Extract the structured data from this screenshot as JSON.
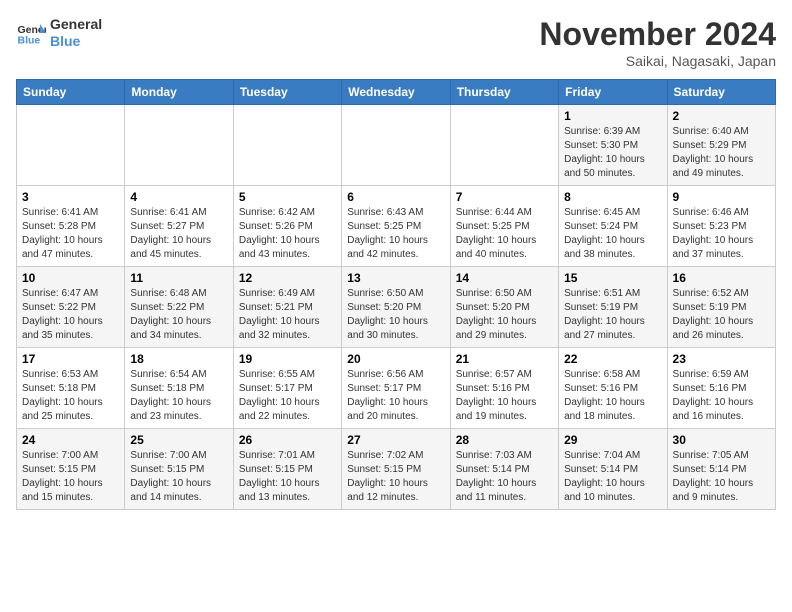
{
  "logo": {
    "line1": "General",
    "line2": "Blue"
  },
  "title": "November 2024",
  "subtitle": "Saikai, Nagasaki, Japan",
  "days_header": [
    "Sunday",
    "Monday",
    "Tuesday",
    "Wednesday",
    "Thursday",
    "Friday",
    "Saturday"
  ],
  "weeks": [
    [
      {
        "day": "",
        "info": ""
      },
      {
        "day": "",
        "info": ""
      },
      {
        "day": "",
        "info": ""
      },
      {
        "day": "",
        "info": ""
      },
      {
        "day": "",
        "info": ""
      },
      {
        "day": "1",
        "info": "Sunrise: 6:39 AM\nSunset: 5:30 PM\nDaylight: 10 hours\nand 50 minutes."
      },
      {
        "day": "2",
        "info": "Sunrise: 6:40 AM\nSunset: 5:29 PM\nDaylight: 10 hours\nand 49 minutes."
      }
    ],
    [
      {
        "day": "3",
        "info": "Sunrise: 6:41 AM\nSunset: 5:28 PM\nDaylight: 10 hours\nand 47 minutes."
      },
      {
        "day": "4",
        "info": "Sunrise: 6:41 AM\nSunset: 5:27 PM\nDaylight: 10 hours\nand 45 minutes."
      },
      {
        "day": "5",
        "info": "Sunrise: 6:42 AM\nSunset: 5:26 PM\nDaylight: 10 hours\nand 43 minutes."
      },
      {
        "day": "6",
        "info": "Sunrise: 6:43 AM\nSunset: 5:25 PM\nDaylight: 10 hours\nand 42 minutes."
      },
      {
        "day": "7",
        "info": "Sunrise: 6:44 AM\nSunset: 5:25 PM\nDaylight: 10 hours\nand 40 minutes."
      },
      {
        "day": "8",
        "info": "Sunrise: 6:45 AM\nSunset: 5:24 PM\nDaylight: 10 hours\nand 38 minutes."
      },
      {
        "day": "9",
        "info": "Sunrise: 6:46 AM\nSunset: 5:23 PM\nDaylight: 10 hours\nand 37 minutes."
      }
    ],
    [
      {
        "day": "10",
        "info": "Sunrise: 6:47 AM\nSunset: 5:22 PM\nDaylight: 10 hours\nand 35 minutes."
      },
      {
        "day": "11",
        "info": "Sunrise: 6:48 AM\nSunset: 5:22 PM\nDaylight: 10 hours\nand 34 minutes."
      },
      {
        "day": "12",
        "info": "Sunrise: 6:49 AM\nSunset: 5:21 PM\nDaylight: 10 hours\nand 32 minutes."
      },
      {
        "day": "13",
        "info": "Sunrise: 6:50 AM\nSunset: 5:20 PM\nDaylight: 10 hours\nand 30 minutes."
      },
      {
        "day": "14",
        "info": "Sunrise: 6:50 AM\nSunset: 5:20 PM\nDaylight: 10 hours\nand 29 minutes."
      },
      {
        "day": "15",
        "info": "Sunrise: 6:51 AM\nSunset: 5:19 PM\nDaylight: 10 hours\nand 27 minutes."
      },
      {
        "day": "16",
        "info": "Sunrise: 6:52 AM\nSunset: 5:19 PM\nDaylight: 10 hours\nand 26 minutes."
      }
    ],
    [
      {
        "day": "17",
        "info": "Sunrise: 6:53 AM\nSunset: 5:18 PM\nDaylight: 10 hours\nand 25 minutes."
      },
      {
        "day": "18",
        "info": "Sunrise: 6:54 AM\nSunset: 5:18 PM\nDaylight: 10 hours\nand 23 minutes."
      },
      {
        "day": "19",
        "info": "Sunrise: 6:55 AM\nSunset: 5:17 PM\nDaylight: 10 hours\nand 22 minutes."
      },
      {
        "day": "20",
        "info": "Sunrise: 6:56 AM\nSunset: 5:17 PM\nDaylight: 10 hours\nand 20 minutes."
      },
      {
        "day": "21",
        "info": "Sunrise: 6:57 AM\nSunset: 5:16 PM\nDaylight: 10 hours\nand 19 minutes."
      },
      {
        "day": "22",
        "info": "Sunrise: 6:58 AM\nSunset: 5:16 PM\nDaylight: 10 hours\nand 18 minutes."
      },
      {
        "day": "23",
        "info": "Sunrise: 6:59 AM\nSunset: 5:16 PM\nDaylight: 10 hours\nand 16 minutes."
      }
    ],
    [
      {
        "day": "24",
        "info": "Sunrise: 7:00 AM\nSunset: 5:15 PM\nDaylight: 10 hours\nand 15 minutes."
      },
      {
        "day": "25",
        "info": "Sunrise: 7:00 AM\nSunset: 5:15 PM\nDaylight: 10 hours\nand 14 minutes."
      },
      {
        "day": "26",
        "info": "Sunrise: 7:01 AM\nSunset: 5:15 PM\nDaylight: 10 hours\nand 13 minutes."
      },
      {
        "day": "27",
        "info": "Sunrise: 7:02 AM\nSunset: 5:15 PM\nDaylight: 10 hours\nand 12 minutes."
      },
      {
        "day": "28",
        "info": "Sunrise: 7:03 AM\nSunset: 5:14 PM\nDaylight: 10 hours\nand 11 minutes."
      },
      {
        "day": "29",
        "info": "Sunrise: 7:04 AM\nSunset: 5:14 PM\nDaylight: 10 hours\nand 10 minutes."
      },
      {
        "day": "30",
        "info": "Sunrise: 7:05 AM\nSunset: 5:14 PM\nDaylight: 10 hours\nand 9 minutes."
      }
    ]
  ]
}
